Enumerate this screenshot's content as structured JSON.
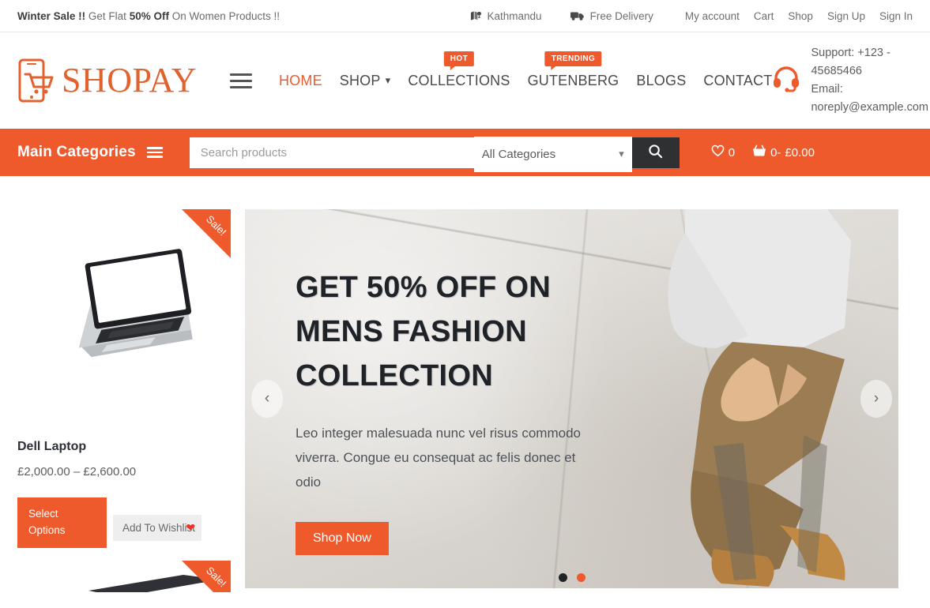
{
  "topbar": {
    "promo_strong": "Winter Sale !!",
    "promo_mid": " Get Flat ",
    "promo_bold": "50% Off",
    "promo_end": " On Women Products !!",
    "location": "Kathmandu",
    "delivery": "Free Delivery",
    "links": [
      "My account",
      "Cart",
      "Shop",
      "Sign Up",
      "Sign In"
    ],
    "location_icon": "map-location-icon",
    "delivery_icon": "truck-icon"
  },
  "header": {
    "logo_text": "SHOPAY",
    "logo_icon": "phone-cart-icon",
    "menu_icon": "hamburger-icon",
    "nav": [
      {
        "label": "HOME",
        "active": true,
        "badge": "",
        "caret": false
      },
      {
        "label": "SHOP",
        "active": false,
        "badge": "",
        "caret": true
      },
      {
        "label": "COLLECTIONS",
        "active": false,
        "badge": "HOT",
        "caret": false
      },
      {
        "label": "GUTENBERG",
        "active": false,
        "badge": "TRENDING",
        "caret": false
      },
      {
        "label": "BLOGS",
        "active": false,
        "badge": "",
        "caret": false
      },
      {
        "label": "CONTACT",
        "active": false,
        "badge": "",
        "caret": false
      }
    ],
    "support_icon": "headset-icon",
    "support_phone": "Support: +123 - 45685466",
    "support_email": "Email: noreply@example.com"
  },
  "searchbar": {
    "main_categories_label": "Main Categories",
    "main_categories_icon": "hamburger-icon",
    "search_placeholder": "Search products",
    "search_value": "",
    "category_selected": "All Categories",
    "category_options": [
      "All Categories"
    ],
    "search_icon": "search-icon",
    "wishlist_icon": "heart-outline-icon",
    "wishlist_count": "0",
    "cart_icon": "basket-icon",
    "cart_count": "0-",
    "cart_total": "£0.00"
  },
  "sidebar": {
    "product": {
      "badge": "Sale!",
      "image_icon": "laptop-image",
      "title": "Dell Laptop",
      "price": "£2,000.00 – £2,600.00",
      "select_options_label": "Select Options",
      "wishlist_label": "Add To Wishlist",
      "wishlist_icon": "heart-filled-icon"
    },
    "product_next": {
      "badge": "Sale!",
      "image_icon": "keyboard-image"
    }
  },
  "hero": {
    "title_lines": [
      "GET 50% OFF ON",
      "MENS FASHION",
      "COLLECTION"
    ],
    "subtitle": "Leo integer malesuada nunc vel risus commodo viverra. Congue eu consequat ac felis donec et odio",
    "cta_label": "Shop Now",
    "prev_icon": "chevron-left-icon",
    "next_icon": "chevron-right-icon",
    "slides": 2,
    "active_slide": 2
  },
  "colors": {
    "accent": "#ef5a2c",
    "dark": "#2f3032",
    "text": "#4a4a4a",
    "heart_red": "#e8342a"
  }
}
